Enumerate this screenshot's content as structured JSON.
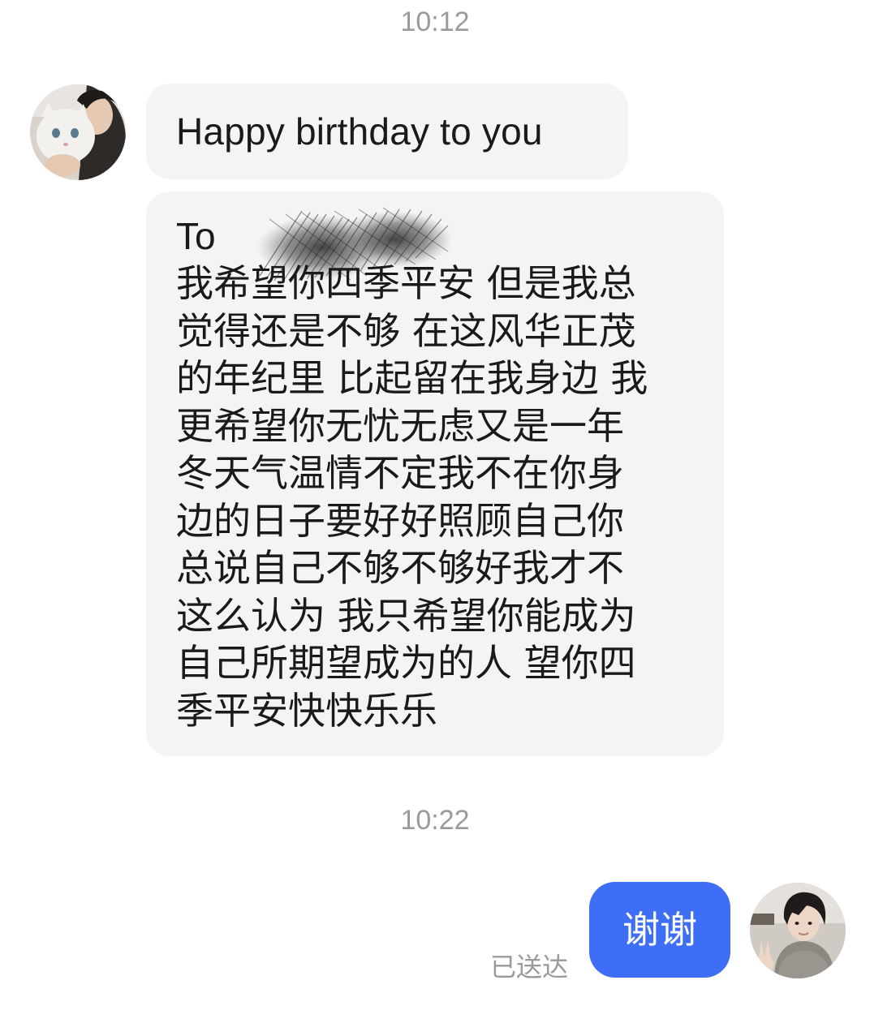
{
  "messages": {
    "ts1": "10:12",
    "bubble1": "Happy birthday to you",
    "bubble2": {
      "to_label": "To",
      "lines": [
        "我希望你四季平安 但是我总",
        "觉得还是不够 在这风华正茂",
        "的年纪里 比起留在我身边 我",
        "更希望你无忧无虑又是一年",
        "冬天气温情不定我不在你身",
        "边的日子要好好照顾自己你",
        "总说自己不够不够好我才不",
        "这么认为 我只希望你能成为",
        "自己所期望成为的人 望你四",
        "季平安快快乐乐"
      ]
    },
    "ts2": "10:22",
    "reply": "谢谢",
    "status": "已送达"
  },
  "colors": {
    "bubble_incoming": "#f4f4f5",
    "bubble_outgoing": "#3d6ef5",
    "timestamp": "#9a9a9a"
  }
}
